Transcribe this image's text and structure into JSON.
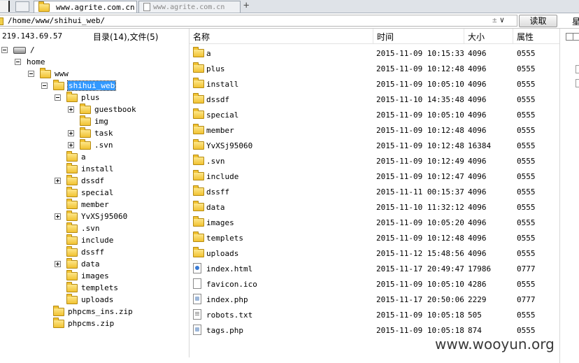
{
  "tabs": [
    {
      "label": "www.agrite.com.cn",
      "active": true
    },
    {
      "label": "www.agrite.com.cn",
      "active": false
    }
  ],
  "tab_add": "+",
  "path": {
    "value": "/home/www/shihui_web/",
    "controls": "±",
    "dropdown": "∨",
    "read_button": "读取"
  },
  "right_glyph": "星",
  "left": {
    "ip": "219.143.69.57",
    "counts": "目录(14),文件(5)",
    "tree": [
      {
        "label": "/",
        "depth": 0,
        "state": "minus",
        "icon": "drive"
      },
      {
        "label": "home",
        "depth": 1,
        "state": "minus",
        "icon": "none"
      },
      {
        "label": "www",
        "depth": 2,
        "state": "minus",
        "icon": "folder"
      },
      {
        "label": "shihui_web",
        "depth": 3,
        "state": "minus",
        "icon": "folder",
        "selected": true
      },
      {
        "label": "plus",
        "depth": 4,
        "state": "minus",
        "icon": "folder"
      },
      {
        "label": "guestbook",
        "depth": 5,
        "state": "plus",
        "icon": "folder"
      },
      {
        "label": "img",
        "depth": 5,
        "state": "none",
        "icon": "folder"
      },
      {
        "label": "task",
        "depth": 5,
        "state": "plus",
        "icon": "folder"
      },
      {
        "label": ".svn",
        "depth": 5,
        "state": "plus",
        "icon": "folder"
      },
      {
        "label": "a",
        "depth": 4,
        "state": "none",
        "icon": "folder"
      },
      {
        "label": "install",
        "depth": 4,
        "state": "none",
        "icon": "folder"
      },
      {
        "label": "dssdf",
        "depth": 4,
        "state": "plus",
        "icon": "folder"
      },
      {
        "label": "special",
        "depth": 4,
        "state": "none",
        "icon": "folder"
      },
      {
        "label": "member",
        "depth": 4,
        "state": "none",
        "icon": "folder"
      },
      {
        "label": "YvXSj95060",
        "depth": 4,
        "state": "plus",
        "icon": "folder"
      },
      {
        "label": ".svn",
        "depth": 4,
        "state": "none",
        "icon": "folder"
      },
      {
        "label": "include",
        "depth": 4,
        "state": "none",
        "icon": "folder"
      },
      {
        "label": "dssff",
        "depth": 4,
        "state": "none",
        "icon": "folder"
      },
      {
        "label": "data",
        "depth": 4,
        "state": "plus",
        "icon": "folder"
      },
      {
        "label": "images",
        "depth": 4,
        "state": "none",
        "icon": "folder"
      },
      {
        "label": "templets",
        "depth": 4,
        "state": "none",
        "icon": "folder"
      },
      {
        "label": "uploads",
        "depth": 4,
        "state": "none",
        "icon": "folder"
      },
      {
        "label": "phpcms_ins.zip",
        "depth": 3,
        "state": "none",
        "icon": "folder"
      },
      {
        "label": "phpcms.zip",
        "depth": 3,
        "state": "none",
        "icon": "folder"
      }
    ]
  },
  "list": {
    "columns": [
      "名称",
      "时间",
      "大小",
      "属性"
    ],
    "rows": [
      {
        "name": "a",
        "time": "2015-11-09 10:15:33",
        "size": "4096",
        "attr": "0555",
        "type": "folder"
      },
      {
        "name": "plus",
        "time": "2015-11-09 10:12:48",
        "size": "4096",
        "attr": "0555",
        "type": "folder"
      },
      {
        "name": "install",
        "time": "2015-11-09 10:05:10",
        "size": "4096",
        "attr": "0555",
        "type": "folder"
      },
      {
        "name": "dssdf",
        "time": "2015-11-10 14:35:48",
        "size": "4096",
        "attr": "0555",
        "type": "folder"
      },
      {
        "name": "special",
        "time": "2015-11-09 10:05:10",
        "size": "4096",
        "attr": "0555",
        "type": "folder"
      },
      {
        "name": "member",
        "time": "2015-11-09 10:12:48",
        "size": "4096",
        "attr": "0555",
        "type": "folder"
      },
      {
        "name": "YvXSj95060",
        "time": "2015-11-09 10:12:48",
        "size": "16384",
        "attr": "0555",
        "type": "folder"
      },
      {
        "name": ".svn",
        "time": "2015-11-09 10:12:49",
        "size": "4096",
        "attr": "0555",
        "type": "folder"
      },
      {
        "name": "include",
        "time": "2015-11-09 10:12:47",
        "size": "4096",
        "attr": "0555",
        "type": "folder"
      },
      {
        "name": "dssff",
        "time": "2015-11-11 00:15:37",
        "size": "4096",
        "attr": "0555",
        "type": "folder"
      },
      {
        "name": "data",
        "time": "2015-11-10 11:32:12",
        "size": "4096",
        "attr": "0555",
        "type": "folder"
      },
      {
        "name": "images",
        "time": "2015-11-09 10:05:20",
        "size": "4096",
        "attr": "0555",
        "type": "folder"
      },
      {
        "name": "templets",
        "time": "2015-11-09 10:12:48",
        "size": "4096",
        "attr": "0555",
        "type": "folder"
      },
      {
        "name": "uploads",
        "time": "2015-11-12 15:48:56",
        "size": "4096",
        "attr": "0555",
        "type": "folder"
      },
      {
        "name": "index.html",
        "time": "2015-11-17 20:49:47",
        "size": "17986",
        "attr": "0777",
        "type": "html"
      },
      {
        "name": "favicon.ico",
        "time": "2015-11-09 10:05:10",
        "size": "4286",
        "attr": "0555",
        "type": "file"
      },
      {
        "name": "index.php",
        "time": "2015-11-17 20:50:06",
        "size": "2229",
        "attr": "0777",
        "type": "php"
      },
      {
        "name": "robots.txt",
        "time": "2015-11-09 10:05:18",
        "size": "505",
        "attr": "0555",
        "type": "txt"
      },
      {
        "name": "tags.php",
        "time": "2015-11-09 10:05:18",
        "size": "874",
        "attr": "0555",
        "type": "php"
      }
    ]
  },
  "watermark": "www.wooyun.org",
  "colors": {
    "selection": "#3399ff",
    "folder": "#f1c232"
  }
}
